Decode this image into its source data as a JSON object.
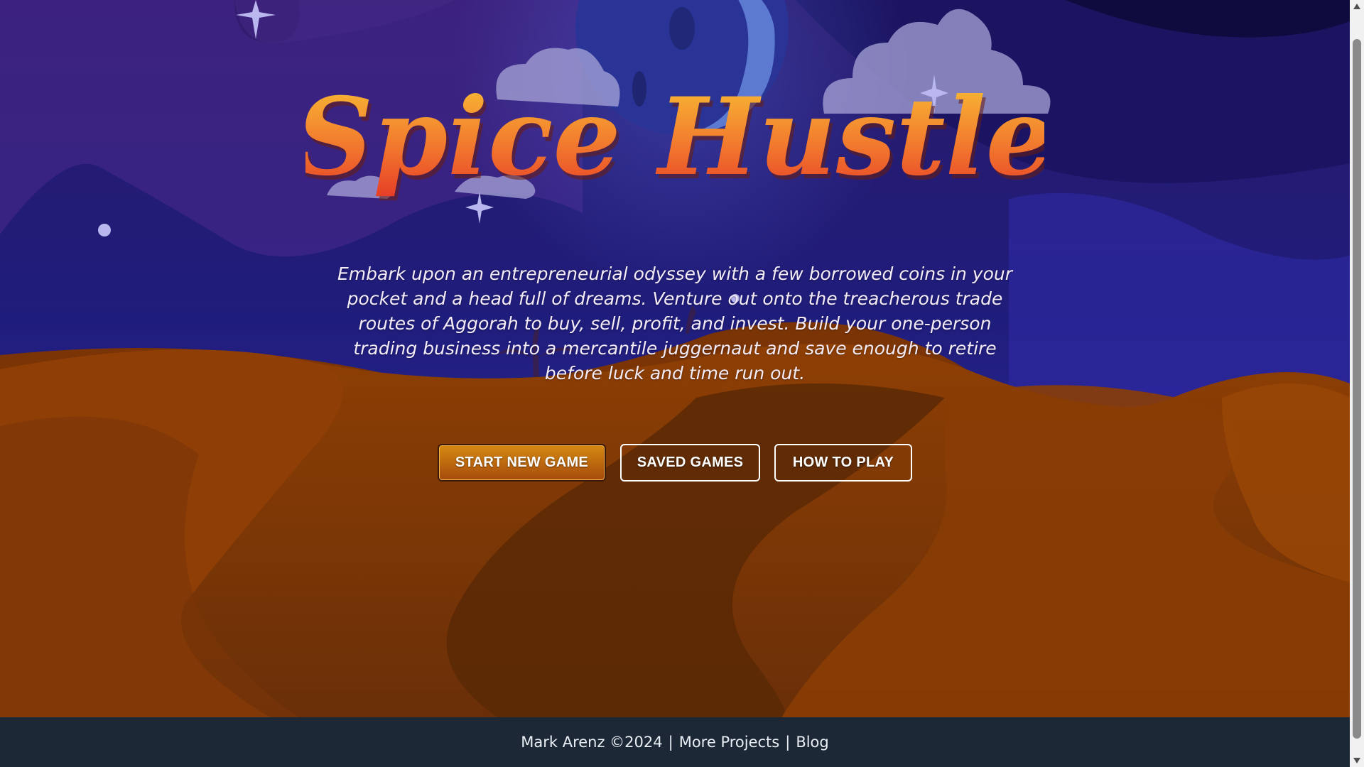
{
  "game": {
    "title": "Spice Hustle",
    "tagline": "Embark upon an entrepreneurial odyssey with a few borrowed coins in your pocket and a head full of dreams. Venture out onto the treacherous trade routes of Aggorah to buy, sell, profit, and invest. Build your one-person trading business into a mercantile juggernaut and save enough to retire before luck and time run out."
  },
  "menu": {
    "start_label": "START NEW GAME",
    "saved_label": "SAVED GAMES",
    "how_label": "HOW TO PLAY"
  },
  "footer": {
    "author": "Mark Arenz ©2024",
    "separator": "|",
    "projects_label": "More Projects",
    "blog_label": "Blog"
  },
  "colors": {
    "sky_top": "#2a1d6e",
    "sky_bottom": "#3a2fa8",
    "sand": "#8a3f05",
    "sand_dark": "#5a2a06",
    "title_top": "#f7b52e",
    "title_bottom": "#e83a2a",
    "footer_bg": "#1d2837",
    "button_primary": "#c66f10"
  },
  "icons": {
    "scroll_up": "scroll-up-arrow-icon",
    "scroll_down": "scroll-down-arrow-icon"
  }
}
